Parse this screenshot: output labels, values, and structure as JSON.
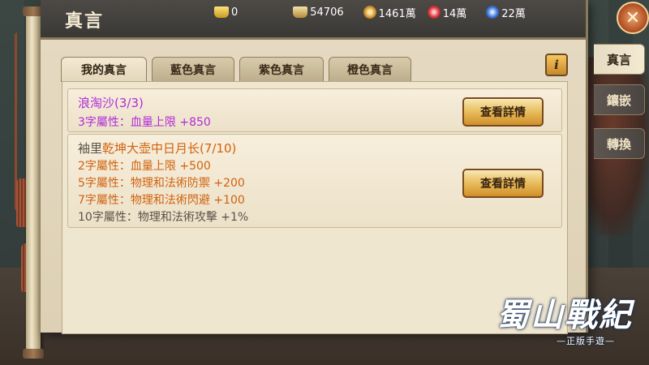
{
  "panel": {
    "title": "真言"
  },
  "currencies": [
    {
      "icon": "gold-ingot-icon",
      "value": "0"
    },
    {
      "icon": "silver-ingot-icon",
      "value": "54706"
    },
    {
      "icon": "copper-coin-icon",
      "value": "1461萬"
    },
    {
      "icon": "red-orb-icon",
      "value": "14萬"
    },
    {
      "icon": "blue-orb-icon",
      "value": "22萬"
    }
  ],
  "tabs": [
    {
      "label": "我的真言"
    },
    {
      "label": "藍色真言"
    },
    {
      "label": "紫色真言"
    },
    {
      "label": "橙色真言"
    }
  ],
  "info_button": "i",
  "cards": [
    {
      "title": "浪淘沙(3/3)",
      "lines": [
        "3字屬性：血量上限 +850"
      ],
      "button": "查看詳情"
    },
    {
      "title_prefix": "袖里",
      "title_main": "乾坤大壶中日月长(7/10)",
      "lines": [
        "2字屬性：血量上限 +500",
        "5字屬性：物理和法術防禦 +200",
        "7字屬性：物理和法術閃避 +100",
        "10字屬性：物理和法術攻擊 +1%"
      ],
      "button": "查看詳情"
    }
  ],
  "side_tabs": [
    {
      "label": "真言"
    },
    {
      "label": "鑲嵌"
    },
    {
      "label": "轉換"
    }
  ],
  "close_button": "✕",
  "logo": {
    "main": "蜀山戰紀",
    "sub": "—正版手遊—"
  }
}
